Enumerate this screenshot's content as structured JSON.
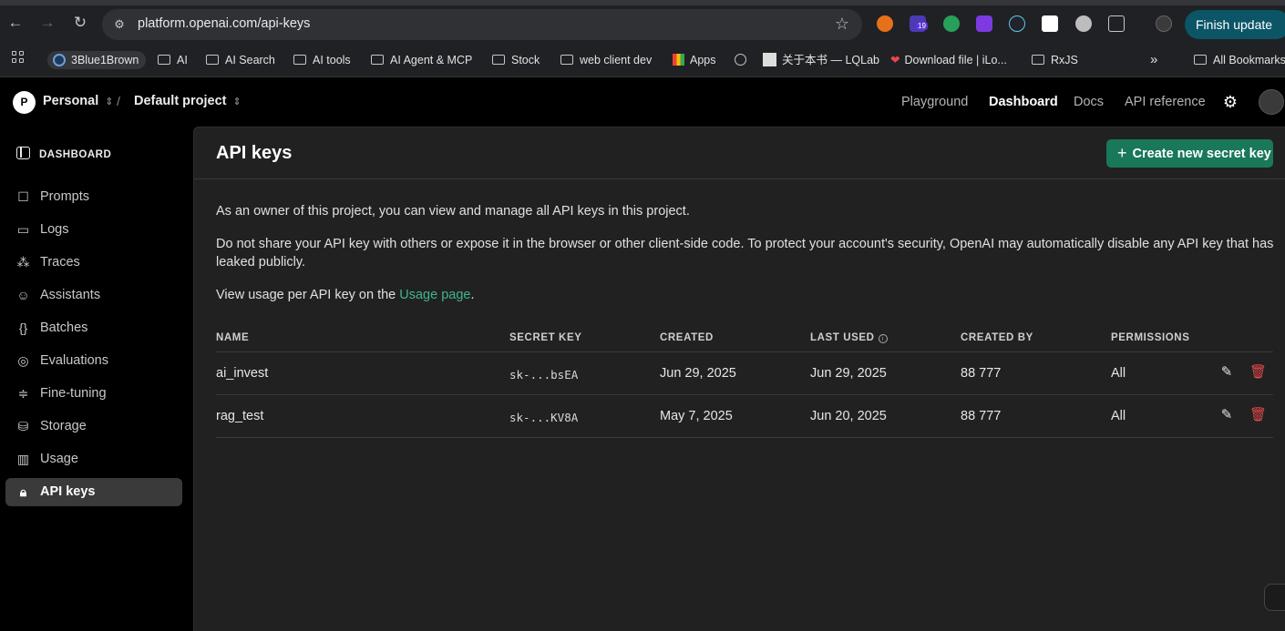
{
  "browser": {
    "url": "platform.openai.com/api-keys",
    "finish_update": "Finish update",
    "ext_badge": "19"
  },
  "bookmarks": {
    "items": [
      {
        "label": "3Blue1Brown"
      },
      {
        "label": "AI"
      },
      {
        "label": "AI Search"
      },
      {
        "label": "AI tools"
      },
      {
        "label": "AI Agent & MCP"
      },
      {
        "label": "Stock"
      },
      {
        "label": "web client dev"
      },
      {
        "label": "Apps"
      },
      {
        "label": "关于本书 — LQLab"
      },
      {
        "label": "Download file | iLo..."
      },
      {
        "label": "RxJS"
      }
    ],
    "more": "»",
    "all_bookmarks": "All Bookmarks"
  },
  "topnav": {
    "avatar_letter": "P",
    "org": "Personal",
    "separator": "/",
    "project": "Default project",
    "links": [
      "Playground",
      "Dashboard",
      "Docs",
      "API reference"
    ]
  },
  "sidebar": {
    "header": "DASHBOARD",
    "items": [
      {
        "label": "Prompts"
      },
      {
        "label": "Logs"
      },
      {
        "label": "Traces"
      },
      {
        "label": "Assistants"
      },
      {
        "label": "Batches"
      },
      {
        "label": "Evaluations"
      },
      {
        "label": "Fine-tuning"
      },
      {
        "label": "Storage"
      },
      {
        "label": "Usage"
      },
      {
        "label": "API keys"
      }
    ]
  },
  "main": {
    "title": "API keys",
    "create_button": "Create new secret key",
    "para1": "As an owner of this project, you can view and manage all API keys in this project.",
    "para2": "Do not share your API key with others or expose it in the browser or other client-side code. To protect your account's security, OpenAI may automatically disable any API key that has leaked publicly.",
    "para3_prefix": "View usage per API key on the ",
    "para3_link": "Usage page",
    "para3_suffix": ".",
    "columns": [
      "NAME",
      "SECRET KEY",
      "CREATED",
      "LAST USED",
      "CREATED BY",
      "PERMISSIONS"
    ],
    "rows": [
      {
        "name": "ai_invest",
        "key": "sk-...bsEA",
        "created": "Jun 29, 2025",
        "last_used": "Jun 29, 2025",
        "created_by": "88 777",
        "permissions": "All"
      },
      {
        "name": "rag_test",
        "key": "sk-...KV8A",
        "created": "May 7, 2025",
        "last_used": "Jun 20, 2025",
        "created_by": "88 777",
        "permissions": "All"
      }
    ]
  },
  "colors": {
    "accent_green": "#19775a",
    "link_green": "#3fb68b",
    "danger_red": "#e5484d"
  }
}
